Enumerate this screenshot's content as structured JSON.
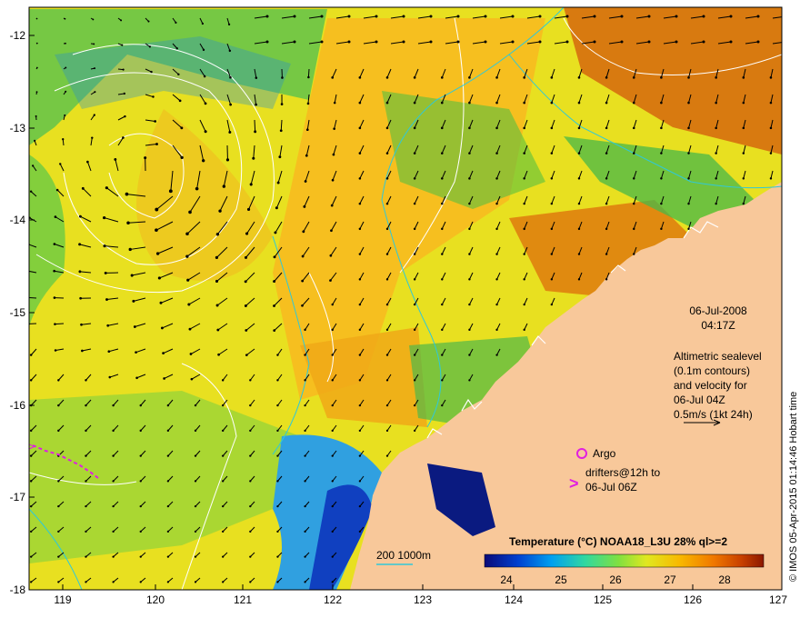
{
  "map": {
    "lon_ticks": [
      "119",
      "120",
      "121",
      "122",
      "123",
      "124",
      "125",
      "126",
      "127"
    ],
    "lat_ticks": [
      "-12",
      "-13",
      "-14",
      "-15",
      "-16",
      "-17",
      "-18"
    ],
    "date_line1": "06-Jul-2008",
    "date_line2": "04:17Z",
    "altimetry_lines": [
      "Altimetric sealevel",
      "(0.1m contours)",
      "and velocity for",
      "06-Jul 04Z",
      "0.5m/s (1kt 24h)"
    ],
    "argo_label": "Argo",
    "drifter_line1": "drifters@12h to",
    "drifter_line2": "06-Jul 06Z",
    "bathy_label": "200  1000m",
    "colorbar_title": "Temperature (°C) NOAA18_L3U 28% ql>=2",
    "colorbar_ticks": [
      "24",
      "25",
      "26",
      "27",
      "28"
    ],
    "credit": "© IMOS 05-Apr-2015 01:14:46 Hobart time",
    "colors": {
      "land": "#f8c89a",
      "argo": "#e020e0",
      "contour": "#ffffff",
      "bathy": "#30c8d8",
      "arrow": "#000000"
    },
    "colorbar_stops": [
      "#0a0a78",
      "#0040d0",
      "#00a0f0",
      "#30d8a0",
      "#80e040",
      "#e0e820",
      "#f8b800",
      "#f07800",
      "#c84000",
      "#8c1800"
    ]
  }
}
